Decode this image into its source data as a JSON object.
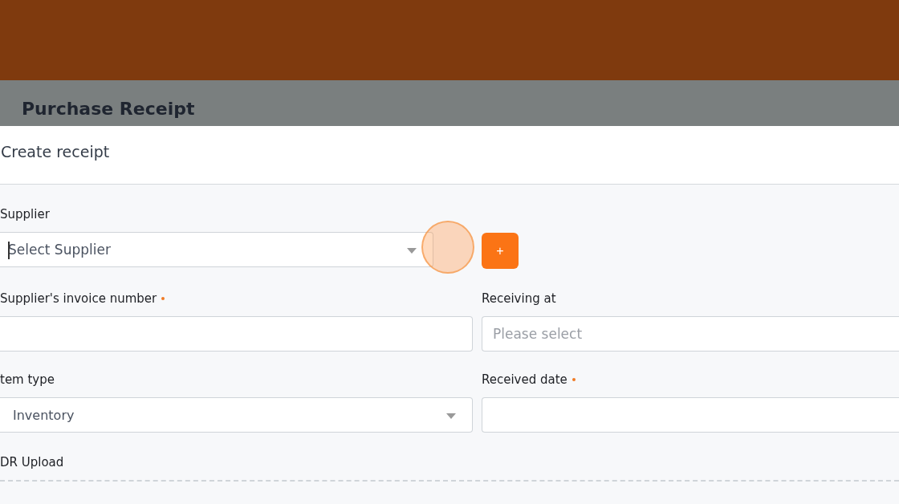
{
  "header": {
    "title": "Purchase Receipt"
  },
  "card": {
    "title": "Create receipt"
  },
  "supplier": {
    "label": "Supplier",
    "placeholder": "Select Supplier",
    "focused": true,
    "highlighted": true,
    "add_button": "+"
  },
  "fields": [
    {
      "label": "Supplier's invoice number",
      "required": true,
      "kind": "text"
    },
    {
      "label": "Receiving at",
      "required": false,
      "kind": "text",
      "placeholder": "Please select"
    },
    {
      "label": "tem type",
      "required": false,
      "kind": "select",
      "value": "Inventory"
    },
    {
      "label": "Received date",
      "required": true,
      "kind": "text"
    }
  ],
  "upload": {
    "label": "DR Upload"
  }
}
